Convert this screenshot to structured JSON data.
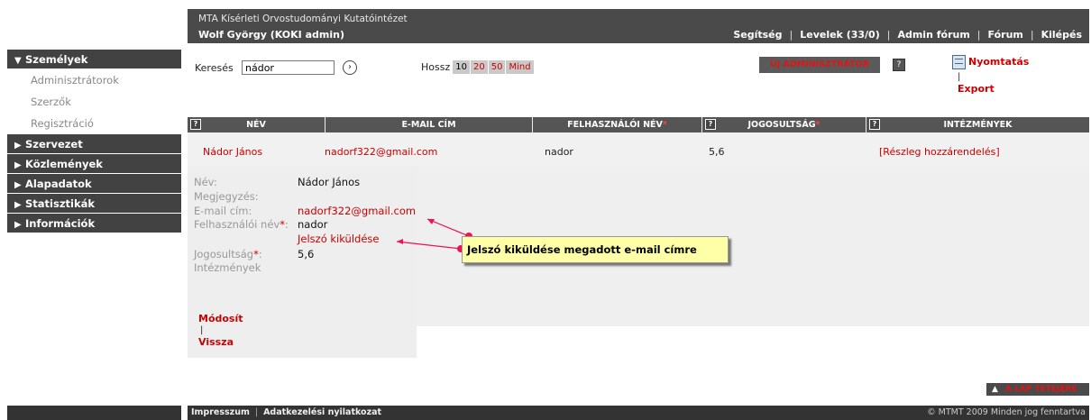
{
  "header": {
    "institution": "MTA Kísérleti Orvostudományi Kutatóintézet",
    "user": "Wolf György (KOKI admin)",
    "nav": [
      "Segítség",
      "Levelek (33/0)",
      "Admin fórum",
      "Fórum",
      "Kilépés"
    ]
  },
  "sidebar": {
    "sections": [
      {
        "label": "Személyek",
        "expanded": true,
        "items": [
          "Adminisztrátorok",
          "Szerzők",
          "Regisztráció"
        ]
      },
      {
        "label": "Szervezet"
      },
      {
        "label": "Közlemények"
      },
      {
        "label": "Alapadatok"
      },
      {
        "label": "Statisztikák"
      },
      {
        "label": "Információk"
      }
    ]
  },
  "toolbar": {
    "search_label": "Keresés",
    "search_value": "nádor",
    "go_icon": "arrow-right-circle-icon",
    "length_label": "Hossz",
    "page_sizes": [
      "10",
      "20",
      "50",
      "Mind"
    ],
    "new_admin": "ÚJ ADMINISZTRÁTOR",
    "help": "?",
    "print": "Nyomtatás",
    "pipe": "|",
    "export": "Export"
  },
  "table": {
    "headers": [
      "NÉV",
      "E-MAIL CÍM",
      "FELHASZNÁLÓI NÉV",
      "JOGOSULTSÁG",
      "INTÉZMÉNYEK"
    ],
    "required_mark": "*",
    "row": {
      "name": "Nádor János",
      "email": "nadorf322@gmail.com",
      "username": "nador",
      "permission": "5,6",
      "institutions": "[Részleg hozzárendelés]"
    }
  },
  "detail": {
    "labels": {
      "name": "Név:",
      "note": "Megjegyzés:",
      "email": "E-mail cím:",
      "username": "Felhasználói név",
      "permission": "Jogosultság",
      "institutions": "Intézmények"
    },
    "req": "*",
    "colon": ":",
    "values": {
      "name": "Nádor János",
      "email": "nadorf322@gmail.com",
      "username": "nador",
      "send_password": "Jelszó kiküldése",
      "permission": "5,6"
    },
    "modify": "Módosít",
    "pipe": "|",
    "back": "Vissza"
  },
  "callout": {
    "text": "Jelszó kiküldése megadott e-mail címre"
  },
  "top_link": "A LAP TETEJÉRE",
  "footer": {
    "links": [
      "Impresszum",
      "Adatkezelési nyilatkozat"
    ],
    "copyright": "© MTMT 2009 Minden jog fenntartva"
  },
  "colors": {
    "accent_red": "#cc0000",
    "dark_bar": "#424242",
    "callout_bg": "#ffffa8",
    "callout_arrow": "#ee1155"
  }
}
